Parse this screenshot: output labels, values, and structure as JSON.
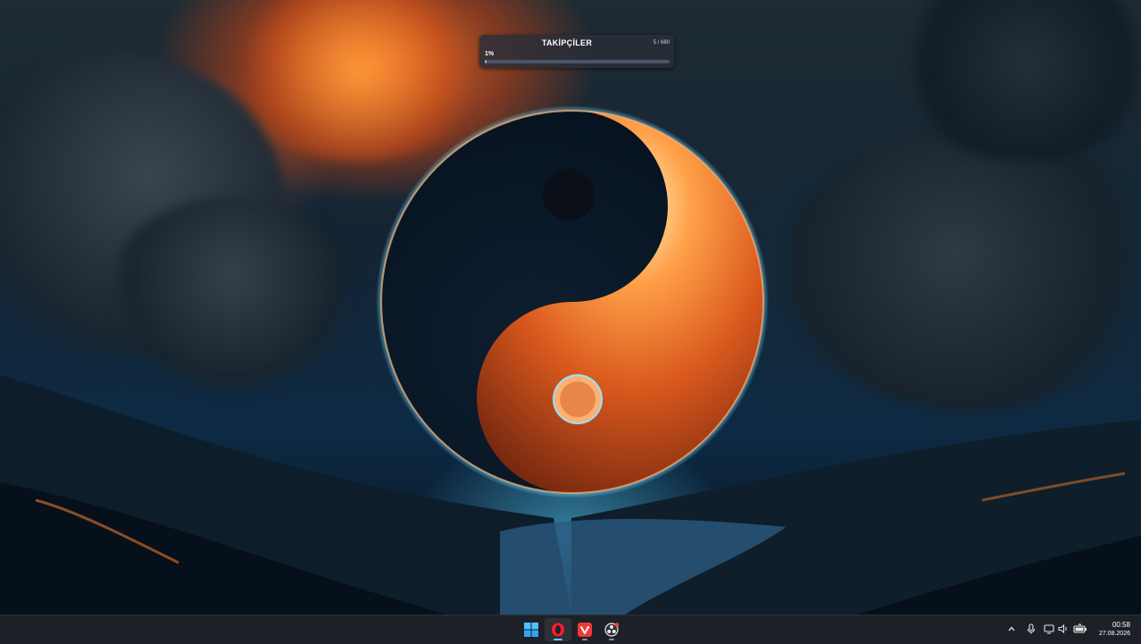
{
  "widget": {
    "title": "TAKİPÇİLER",
    "count": "5 / 680",
    "percent_label": "1%",
    "progress_fraction": 0.01
  },
  "taskbar": {
    "apps": [
      {
        "name": "start-button",
        "icon": "windows-logo-icon"
      },
      {
        "name": "opera-browser",
        "icon": "opera-icon",
        "active": true
      },
      {
        "name": "vivaldi-browser",
        "icon": "vivaldi-icon"
      },
      {
        "name": "obs-studio",
        "icon": "obs-icon"
      }
    ],
    "tray": {
      "icons": [
        "chevron-up-icon",
        "microphone-icon",
        "network-icon",
        "volume-icon",
        "battery-icon"
      ]
    },
    "clock": {
      "time": "00:58",
      "date": "27.08.2026"
    }
  },
  "colors": {
    "taskbar_bg": "#1c2128",
    "accent": "#6cc4ff",
    "opera_red": "#ff1b2d",
    "vivaldi_red": "#ef3939"
  }
}
